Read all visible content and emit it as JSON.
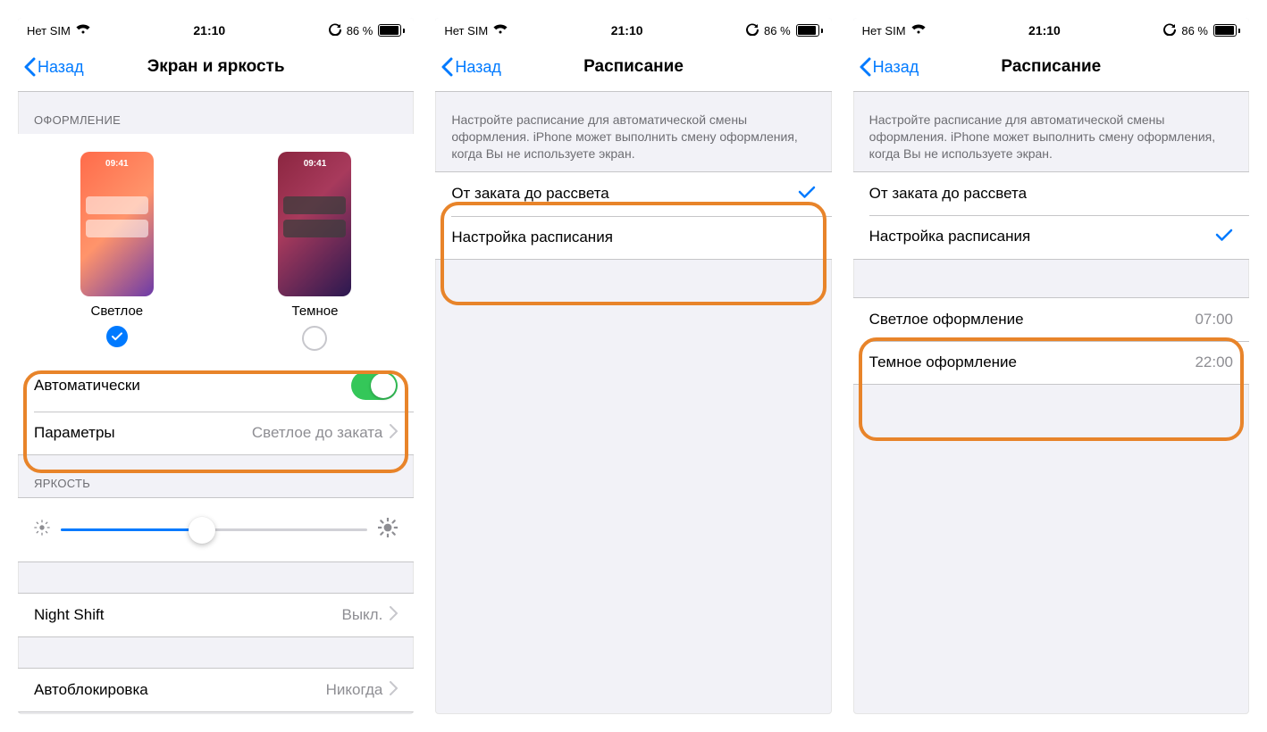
{
  "status": {
    "carrier": "Нет SIM",
    "time": "21:10",
    "battery": "86 %"
  },
  "nav": {
    "back": "Назад"
  },
  "screen1": {
    "title": "Экран и яркость",
    "section_appearance": "ОФОРМЛЕНИЕ",
    "preview_time": "09:41",
    "light_label": "Светлое",
    "dark_label": "Темное",
    "auto_label": "Автоматически",
    "options_label": "Параметры",
    "options_value": "Светлое до заката",
    "section_brightness": "ЯРКОСТЬ",
    "night_shift_label": "Night Shift",
    "night_shift_value": "Выкл.",
    "autolock_label": "Автоблокировка",
    "autolock_value": "Никогда"
  },
  "screen2": {
    "title": "Расписание",
    "note": "Настройте расписание для автоматической смены оформления. iPhone может выполнить смену оформления, когда Вы не используете экран.",
    "opt_sunset": "От заката до рассвета",
    "opt_custom": "Настройка расписания"
  },
  "screen3": {
    "title": "Расписание",
    "note": "Настройте расписание для автоматической смены оформления. iPhone может выполнить смену оформления, когда Вы не используете экран.",
    "opt_sunset": "От заката до рассвета",
    "opt_custom": "Настройка расписания",
    "light_row": "Светлое оформление",
    "light_time": "07:00",
    "dark_row": "Темное оформление",
    "dark_time": "22:00"
  }
}
